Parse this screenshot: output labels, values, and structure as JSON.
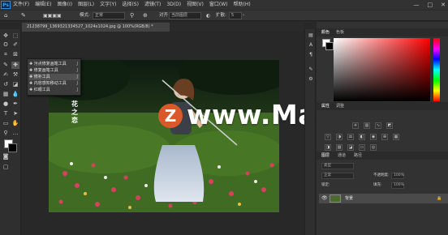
{
  "menubar": {
    "logo": "Ps",
    "items": [
      "文件(F)",
      "编辑(E)",
      "图像(I)",
      "图层(L)",
      "文字(Y)",
      "选择(S)",
      "滤镜(T)",
      "3D(D)",
      "视图(V)",
      "窗口(W)",
      "帮助(H)"
    ],
    "window_buttons": [
      "—",
      "□",
      "✕"
    ]
  },
  "options": {
    "mode_label": "模式:",
    "mode_value": "正常",
    "align_label": "对齐",
    "sample_value": "当前图层",
    "spread_label": "扩散:",
    "spread_value": "5"
  },
  "document": {
    "tab_title": "21238799_1369321334527_1024x1024.jpg @ 100%(RGB/8) *"
  },
  "context_menu": {
    "items": [
      {
        "label": "污点修复画笔工具",
        "shortcut": "J"
      },
      {
        "label": "修复画笔工具",
        "shortcut": "J"
      },
      {
        "label": "修补工具",
        "shortcut": "J"
      },
      {
        "label": "内容感知移动工具",
        "shortcut": "J"
      },
      {
        "label": "红眼工具",
        "shortcut": "J"
      }
    ]
  },
  "watermark": {
    "logo_letter": "Z",
    "text": "www.MacZ.com",
    "vertical_text": "花之恋"
  },
  "panels": {
    "color_tabs": [
      "颜色",
      "色板"
    ],
    "mid_tabs": [
      "属性",
      "调整"
    ],
    "layer_tabs": [
      "图层",
      "通道",
      "路径"
    ],
    "filter_placeholder": "类型",
    "blend_mode": "正常",
    "opacity_label": "不透明度:",
    "opacity_value": "100%",
    "lock_label": "锁定:",
    "fill_label": "填充:",
    "fill_value": "100%",
    "layer_name": "背景"
  }
}
